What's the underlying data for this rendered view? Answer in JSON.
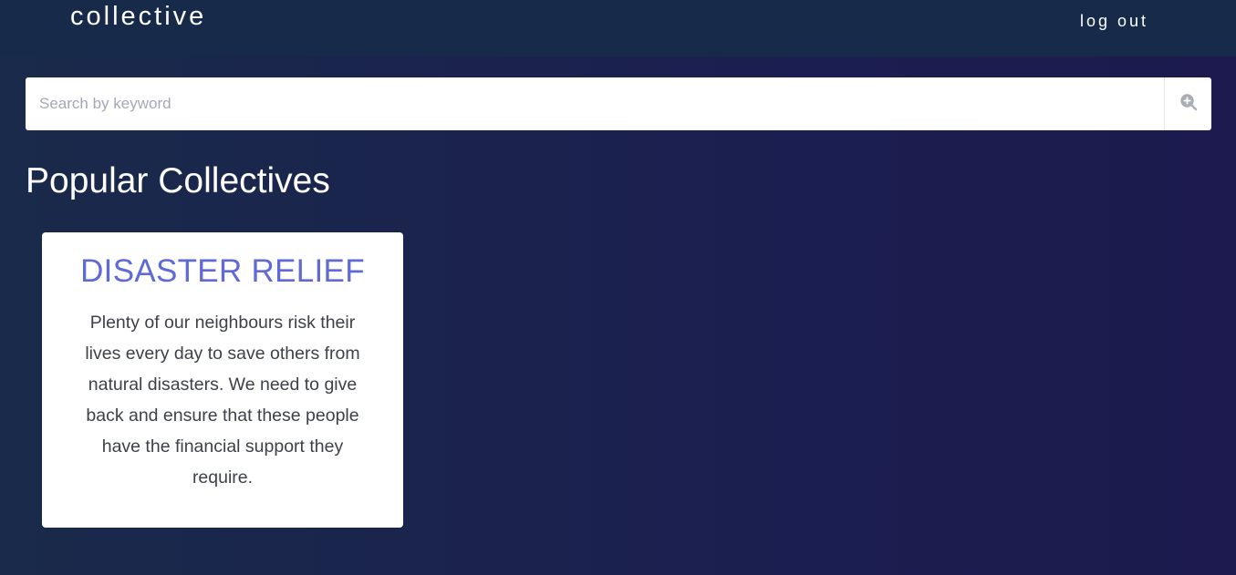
{
  "header": {
    "brand": "collective",
    "logout_label": "log out"
  },
  "search": {
    "placeholder": "Search by keyword",
    "value": "",
    "button_icon": "search-plus-icon"
  },
  "main": {
    "section_title": "Popular Collectives",
    "cards": [
      {
        "title": "DISASTER RELIEF",
        "description": "Plenty of our neighbours risk their lives every day to save others from natural disasters. We need to give back and ensure that these people have the financial support they require."
      }
    ]
  },
  "colors": {
    "header_bg": "#172a4a",
    "page_bg": "#1b1f50",
    "card_title": "#5f6ad8",
    "card_text": "#3d4148",
    "icon": "#a9adb6"
  }
}
